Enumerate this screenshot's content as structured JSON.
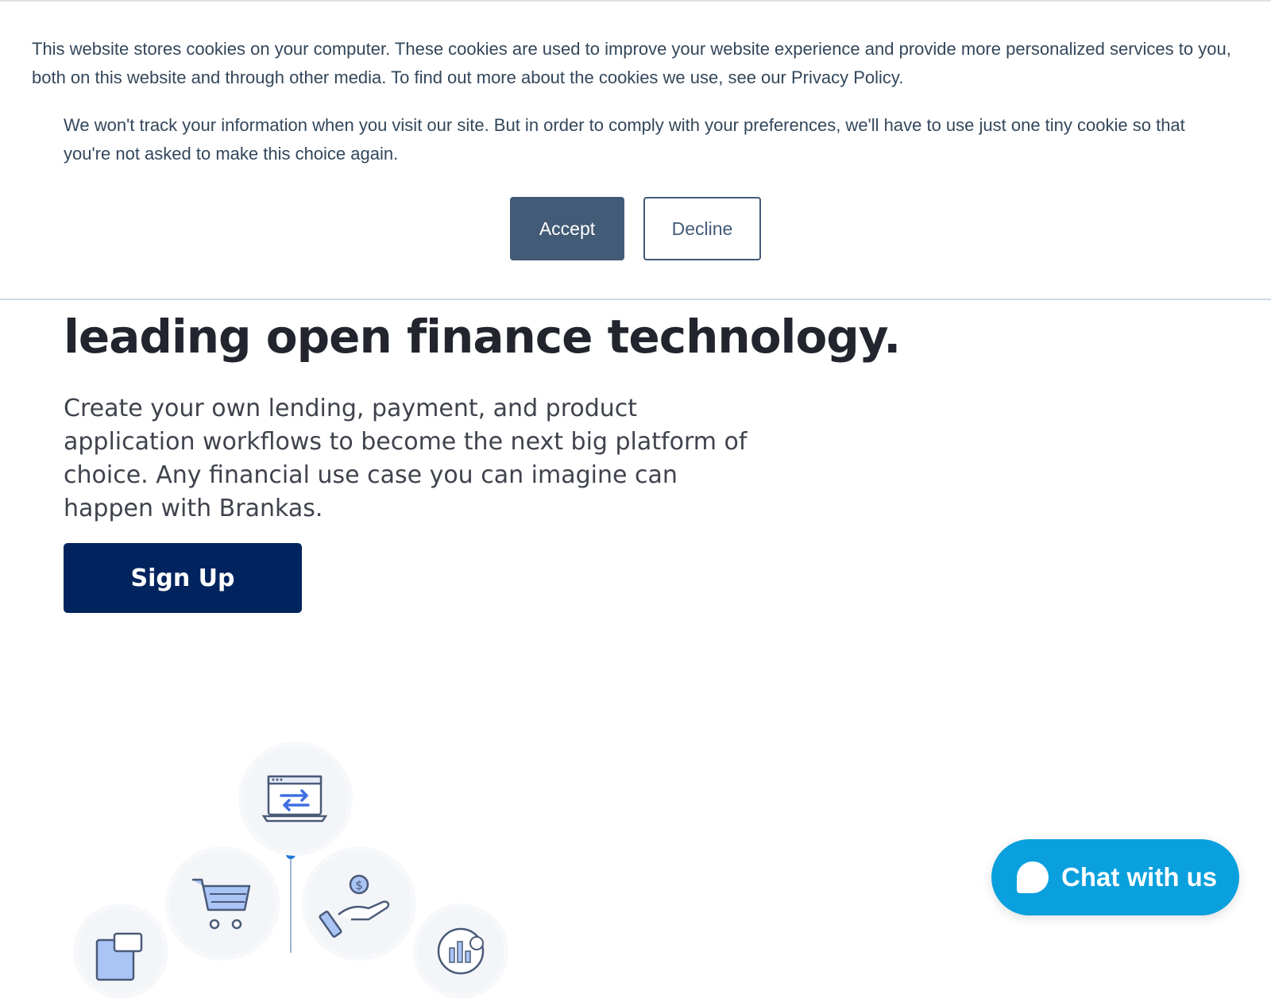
{
  "cookie_banner": {
    "message": "This website stores cookies on your computer. These cookies are used to improve your website experience and provide more personalized services to you, both on this website and through other media. To find out more about the cookies we use, see our Privacy Policy.",
    "decline_note": "We won't track your information when you visit our site. But in order to comply with your preferences, we'll have to use just one tiny cookie so that you're not asked to make this choice again.",
    "accept_label": "Accept",
    "decline_label": "Decline"
  },
  "hero": {
    "headline": "leading open finance technology.",
    "body": "Create your own lending, payment, and product application workflows to become the next big platform of choice. Any financial use case you can imagine can happen with Brankas.",
    "cta_label": "Sign Up"
  },
  "illustration": {
    "icons": [
      "transfer-laptop-icon",
      "shopping-cart-icon",
      "hand-coin-icon",
      "document-icon",
      "analytics-icon"
    ]
  },
  "chat": {
    "label": "Chat with us"
  },
  "colors": {
    "accept_bg": "#425b76",
    "signup_bg": "#02245e",
    "chat_bg": "#0aa0dd",
    "headline_text": "#22252e"
  }
}
